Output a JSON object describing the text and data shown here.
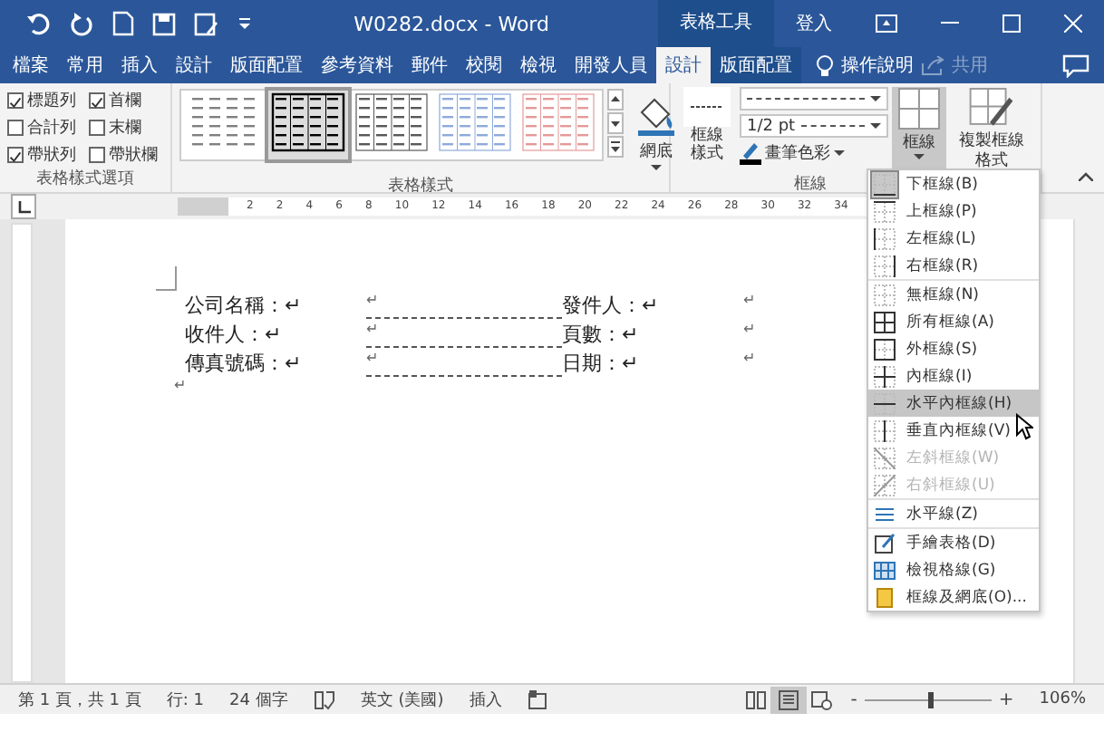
{
  "window": {
    "title": "W0282.docx - Word",
    "context_label": "表格工具",
    "sign_in": "登入"
  },
  "tabs": [
    {
      "label": "檔案",
      "kind": "normal",
      "selected": false
    },
    {
      "label": "常用",
      "kind": "normal",
      "selected": false
    },
    {
      "label": "插入",
      "kind": "normal",
      "selected": false
    },
    {
      "label": "設計",
      "kind": "normal",
      "selected": false
    },
    {
      "label": "版面配置",
      "kind": "normal",
      "selected": false
    },
    {
      "label": "參考資料",
      "kind": "normal",
      "selected": false
    },
    {
      "label": "郵件",
      "kind": "normal",
      "selected": false
    },
    {
      "label": "校閱",
      "kind": "normal",
      "selected": false
    },
    {
      "label": "檢視",
      "kind": "normal",
      "selected": false
    },
    {
      "label": "開發人員",
      "kind": "normal",
      "selected": false
    },
    {
      "label": "設計",
      "kind": "contextual",
      "selected": true
    },
    {
      "label": "版面配置",
      "kind": "contextual",
      "selected": false
    }
  ],
  "tell_me": "操作說明",
  "share": {
    "label": "共用",
    "disabled": true
  },
  "ribbon": {
    "style_options": {
      "label": "表格樣式選項",
      "checkboxes": [
        {
          "label": "標題列",
          "checked": true
        },
        {
          "label": "首欄",
          "checked": true
        },
        {
          "label": "合計列",
          "checked": false
        },
        {
          "label": "末欄",
          "checked": false
        },
        {
          "label": "帶狀列",
          "checked": true
        },
        {
          "label": "帶狀欄",
          "checked": false
        }
      ]
    },
    "table_styles": {
      "label": "表格樣式",
      "gallery": [
        {
          "color": "#808080",
          "selected": false
        },
        {
          "color": "#000000",
          "selected": true
        },
        {
          "color": "#595959",
          "selected": false
        },
        {
          "color": "#8eaadb",
          "selected": false
        },
        {
          "color": "#e59999",
          "selected": false
        }
      ],
      "shading": "網底"
    },
    "borders": {
      "label": "框線",
      "border_styles": "框線樣式",
      "weight": "1/2 pt",
      "pen_color": "畫筆色彩",
      "borders_button": {
        "label": "框線",
        "expanded": true
      },
      "painter": "複製框線格式"
    }
  },
  "ruler": [
    "2",
    "2",
    "4",
    "6",
    "8",
    "10",
    "12",
    "14",
    "16",
    "18",
    "20",
    "22",
    "24",
    "26",
    "28",
    "30",
    "32",
    "34"
  ],
  "document": {
    "rows": [
      {
        "label": "公司名稱：↵",
        "field": "↵",
        "right_label": "發件人：↵",
        "end": "↵"
      },
      {
        "label": "收件人：↵",
        "field": "↵",
        "right_label": "頁數：↵",
        "end": "↵"
      },
      {
        "label": "傳真號碼：↵",
        "field": "↵",
        "right_label": "日期：↵",
        "end": "↵"
      }
    ],
    "last": "↵"
  },
  "border_menu": {
    "sections": [
      [
        {
          "label": "下框線(B)",
          "current": true,
          "selected": false,
          "disabled": false
        },
        {
          "label": "上框線(P)",
          "current": false,
          "selected": false,
          "disabled": false
        },
        {
          "label": "左框線(L)",
          "current": false,
          "selected": false,
          "disabled": false
        },
        {
          "label": "右框線(R)",
          "current": false,
          "selected": false,
          "disabled": false
        }
      ],
      [
        {
          "label": "無框線(N)",
          "current": false,
          "selected": false,
          "disabled": false
        },
        {
          "label": "所有框線(A)",
          "current": false,
          "selected": false,
          "disabled": false
        },
        {
          "label": "外框線(S)",
          "current": false,
          "selected": false,
          "disabled": false
        },
        {
          "label": "內框線(I)",
          "current": false,
          "selected": false,
          "disabled": false
        },
        {
          "label": "水平內框線(H)",
          "current": false,
          "selected": true,
          "disabled": false
        },
        {
          "label": "垂直內框線(V)",
          "current": false,
          "selected": false,
          "disabled": false
        },
        {
          "label": "左斜框線(W)",
          "current": false,
          "selected": false,
          "disabled": true
        },
        {
          "label": "右斜框線(U)",
          "current": false,
          "selected": false,
          "disabled": true
        }
      ],
      [
        {
          "label": "水平線(Z)",
          "current": false,
          "selected": false,
          "disabled": false
        }
      ],
      [
        {
          "label": "手繪表格(D)",
          "current": false,
          "selected": false,
          "disabled": false
        },
        {
          "label": "檢視格線(G)",
          "current": false,
          "selected": false,
          "disabled": false
        },
        {
          "label": "框線及網底(O)...",
          "current": false,
          "selected": false,
          "disabled": false
        }
      ]
    ]
  },
  "status_bar": {
    "page": "第 1 頁，共 1 頁",
    "line": "行: 1",
    "words": "24 個字",
    "language": "英文 (美國)",
    "mode": "插入",
    "views": [
      {
        "selected": false
      },
      {
        "selected": true
      },
      {
        "selected": false
      }
    ],
    "zoom_out": "-",
    "zoom_in": "+",
    "zoom": {
      "level": 0.5
    },
    "zoom_label": "106%"
  }
}
